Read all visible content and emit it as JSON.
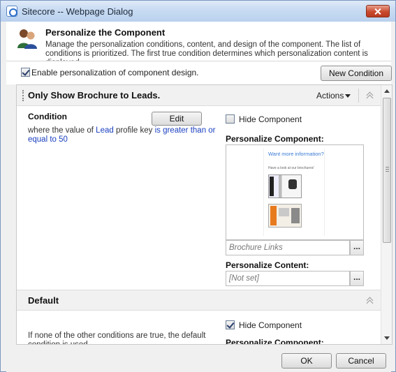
{
  "window": {
    "title": "Sitecore -- Webpage Dialog"
  },
  "header": {
    "title": "Personalize the Component",
    "description": "Manage the personalization conditions, content, and design of the component. The list of conditions is prioritized. The first true condition determines which personalization content is displayed."
  },
  "toolbar": {
    "enable_label": "Enable personalization of component design.",
    "enable_checked": true,
    "new_condition_label": "New Condition"
  },
  "rule": {
    "title": "Only Show Brochure to Leads.",
    "actions_label": "Actions",
    "condition_heading": "Condition",
    "edit_label": "Edit",
    "condition_prefix": "where the value of ",
    "condition_link1": "Lead",
    "condition_mid": " profile key ",
    "condition_link2": "is greater than or equal to 50",
    "hide_label": "Hide Component",
    "hide_checked": false,
    "personalize_component_label": "Personalize Component:",
    "preview": {
      "heading": "Want more information?",
      "subtext": "Have a look at our brochures!"
    },
    "component_value": "Brochure Links",
    "personalize_content_label": "Personalize Content:",
    "content_value": "[Not set]",
    "browse_label": "..."
  },
  "default": {
    "title": "Default",
    "text": "If none of the other conditions are true, the default condition is used.",
    "hide_label": "Hide Component",
    "hide_checked": true,
    "personalize_component_label": "Personalize Component:"
  },
  "footer": {
    "ok_label": "OK",
    "cancel_label": "Cancel"
  }
}
